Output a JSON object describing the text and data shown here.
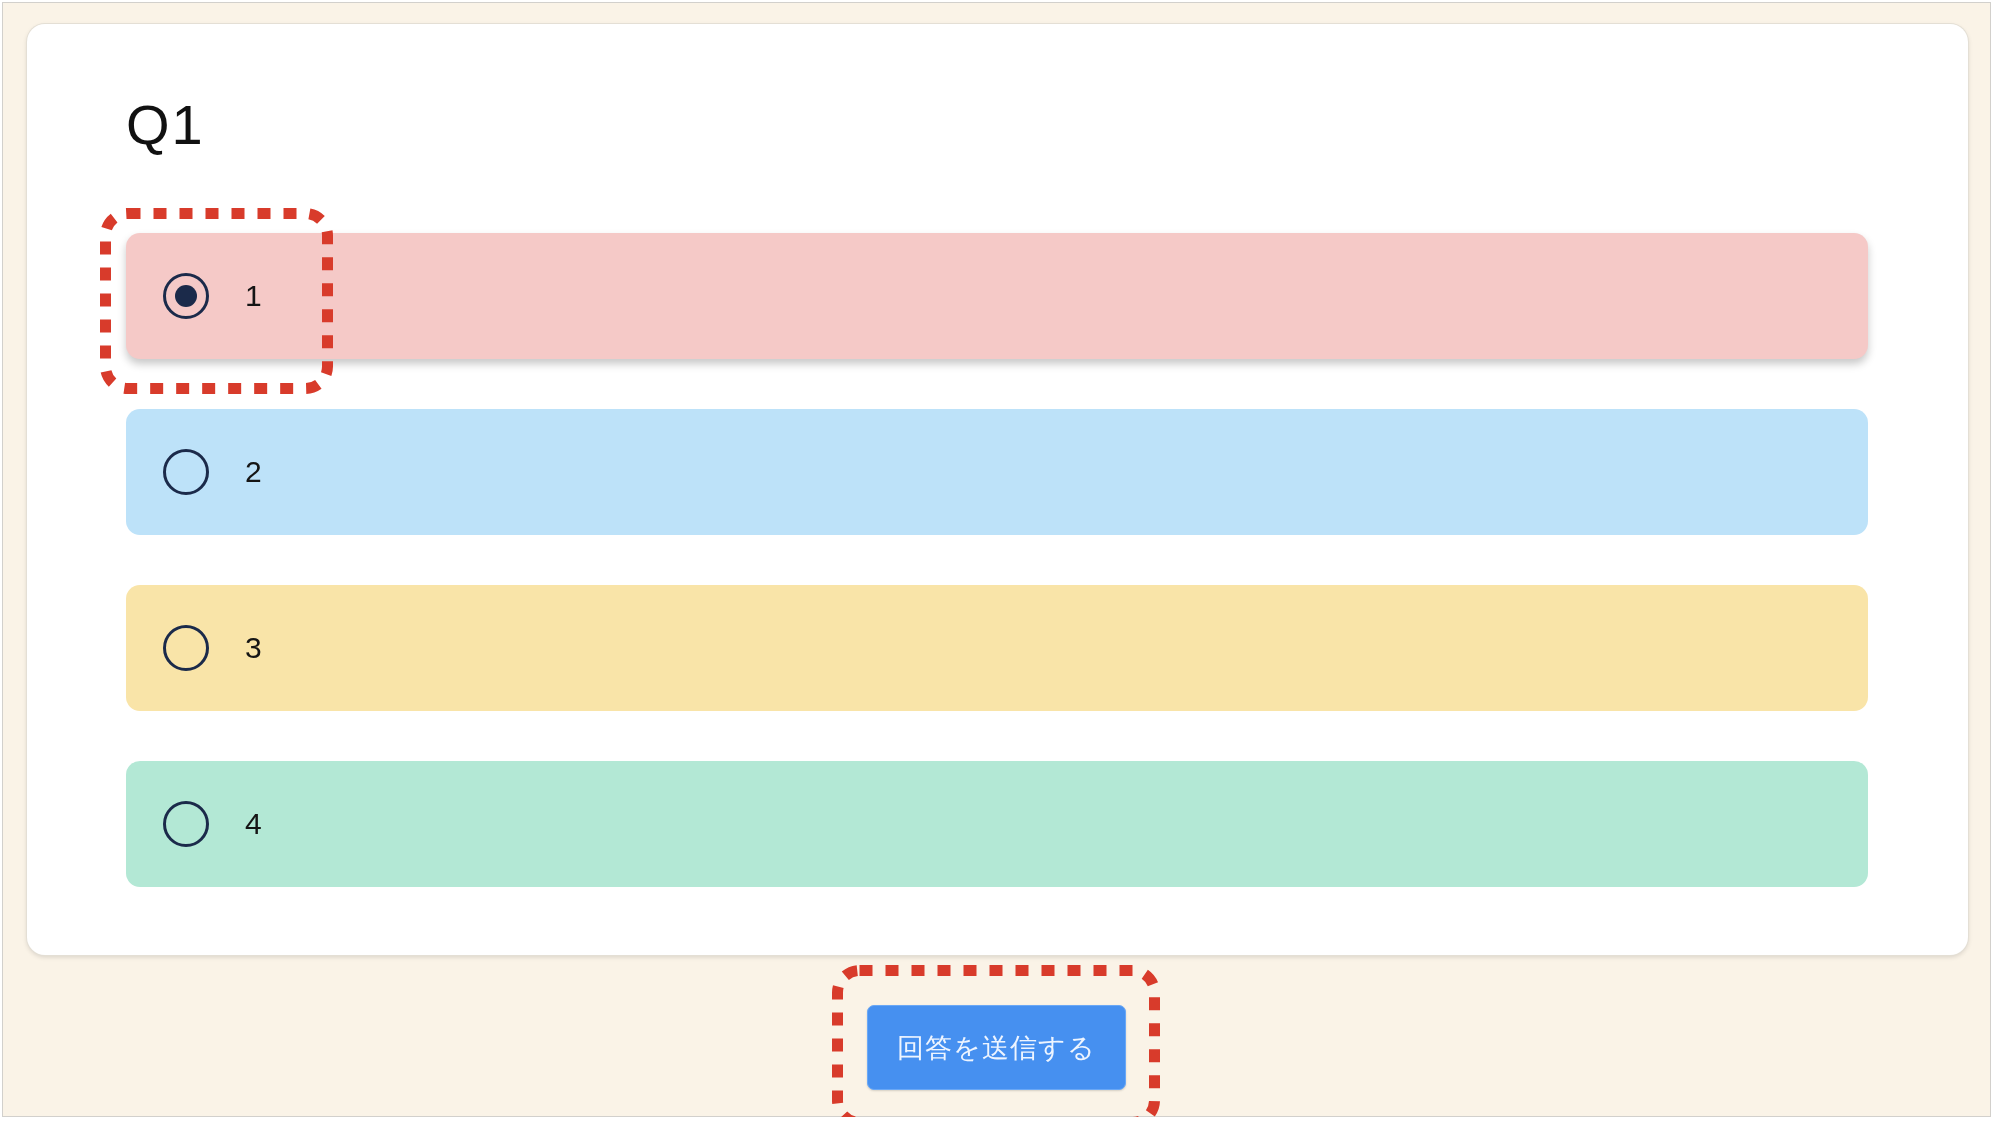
{
  "question": {
    "title": "Q1"
  },
  "options": [
    {
      "label": "1",
      "color": "#f5c9c7",
      "selected": true,
      "highlighted": true
    },
    {
      "label": "2",
      "color": "#bde2f9",
      "selected": false,
      "highlighted": false
    },
    {
      "label": "3",
      "color": "#f9e4a8",
      "selected": false,
      "highlighted": false
    },
    {
      "label": "4",
      "color": "#b3e8d5",
      "selected": false,
      "highlighted": false
    }
  ],
  "submit_button": {
    "label": "回答を送信する",
    "highlighted": true
  }
}
